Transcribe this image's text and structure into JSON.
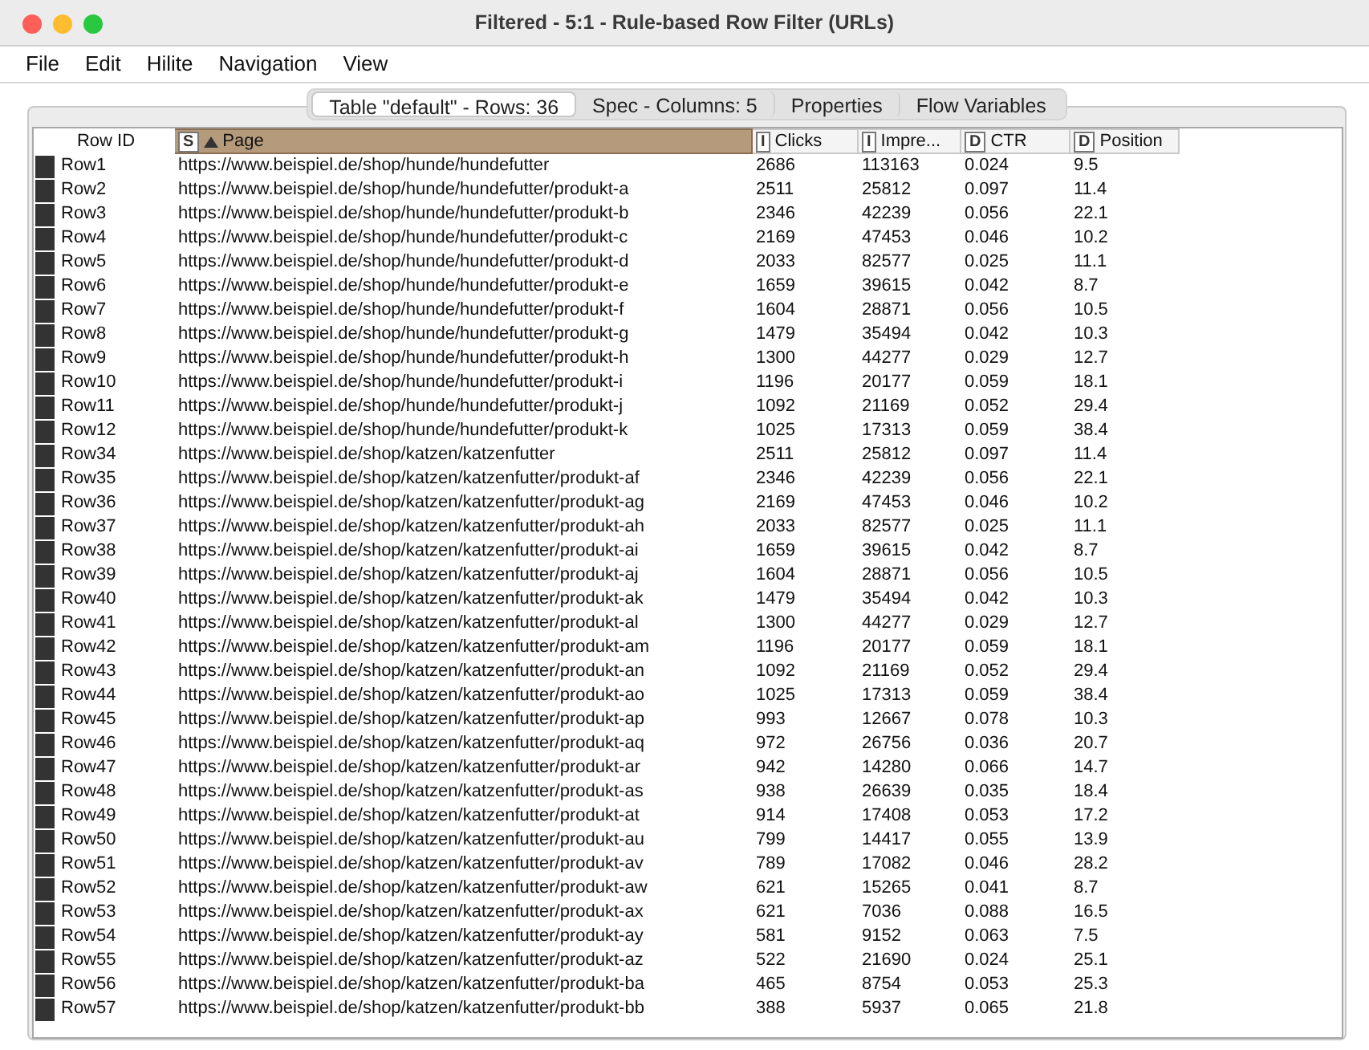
{
  "window": {
    "title": "Filtered - 5:1 - Rule-based Row Filter (URLs)"
  },
  "menu": [
    "File",
    "Edit",
    "Hilite",
    "Navigation",
    "View"
  ],
  "tabs": [
    {
      "label": "Table \"default\" - Rows: 36",
      "selected": true
    },
    {
      "label": "Spec - Columns: 5",
      "selected": false
    },
    {
      "label": "Properties",
      "selected": false
    },
    {
      "label": "Flow Variables",
      "selected": false
    }
  ],
  "table": {
    "columns": [
      {
        "label": "Row ID",
        "selected": false
      },
      {
        "label": "Page",
        "type": "S",
        "sorted_ascending": true,
        "selected": true
      },
      {
        "label": "Clicks",
        "type": "I",
        "selected": false
      },
      {
        "label": "Impre...",
        "type": "I",
        "selected": false
      },
      {
        "label": "CTR",
        "type": "D",
        "selected": false
      },
      {
        "label": "Position",
        "type": "D",
        "selected": false
      }
    ],
    "rows": [
      [
        "Row1",
        "https://www.beispiel.de/shop/hunde/hundefutter",
        "2686",
        "113163",
        "0.024",
        "9.5"
      ],
      [
        "Row2",
        "https://www.beispiel.de/shop/hunde/hundefutter/produkt-a",
        "2511",
        "25812",
        "0.097",
        "11.4"
      ],
      [
        "Row3",
        "https://www.beispiel.de/shop/hunde/hundefutter/produkt-b",
        "2346",
        "42239",
        "0.056",
        "22.1"
      ],
      [
        "Row4",
        "https://www.beispiel.de/shop/hunde/hundefutter/produkt-c",
        "2169",
        "47453",
        "0.046",
        "10.2"
      ],
      [
        "Row5",
        "https://www.beispiel.de/shop/hunde/hundefutter/produkt-d",
        "2033",
        "82577",
        "0.025",
        "11.1"
      ],
      [
        "Row6",
        "https://www.beispiel.de/shop/hunde/hundefutter/produkt-e",
        "1659",
        "39615",
        "0.042",
        "8.7"
      ],
      [
        "Row7",
        "https://www.beispiel.de/shop/hunde/hundefutter/produkt-f",
        "1604",
        "28871",
        "0.056",
        "10.5"
      ],
      [
        "Row8",
        "https://www.beispiel.de/shop/hunde/hundefutter/produkt-g",
        "1479",
        "35494",
        "0.042",
        "10.3"
      ],
      [
        "Row9",
        "https://www.beispiel.de/shop/hunde/hundefutter/produkt-h",
        "1300",
        "44277",
        "0.029",
        "12.7"
      ],
      [
        "Row10",
        "https://www.beispiel.de/shop/hunde/hundefutter/produkt-i",
        "1196",
        "20177",
        "0.059",
        "18.1"
      ],
      [
        "Row11",
        "https://www.beispiel.de/shop/hunde/hundefutter/produkt-j",
        "1092",
        "21169",
        "0.052",
        "29.4"
      ],
      [
        "Row12",
        "https://www.beispiel.de/shop/hunde/hundefutter/produkt-k",
        "1025",
        "17313",
        "0.059",
        "38.4"
      ],
      [
        "Row34",
        "https://www.beispiel.de/shop/katzen/katzenfutter",
        "2511",
        "25812",
        "0.097",
        "11.4"
      ],
      [
        "Row35",
        "https://www.beispiel.de/shop/katzen/katzenfutter/produkt-af",
        "2346",
        "42239",
        "0.056",
        "22.1"
      ],
      [
        "Row36",
        "https://www.beispiel.de/shop/katzen/katzenfutter/produkt-ag",
        "2169",
        "47453",
        "0.046",
        "10.2"
      ],
      [
        "Row37",
        "https://www.beispiel.de/shop/katzen/katzenfutter/produkt-ah",
        "2033",
        "82577",
        "0.025",
        "11.1"
      ],
      [
        "Row38",
        "https://www.beispiel.de/shop/katzen/katzenfutter/produkt-ai",
        "1659",
        "39615",
        "0.042",
        "8.7"
      ],
      [
        "Row39",
        "https://www.beispiel.de/shop/katzen/katzenfutter/produkt-aj",
        "1604",
        "28871",
        "0.056",
        "10.5"
      ],
      [
        "Row40",
        "https://www.beispiel.de/shop/katzen/katzenfutter/produkt-ak",
        "1479",
        "35494",
        "0.042",
        "10.3"
      ],
      [
        "Row41",
        "https://www.beispiel.de/shop/katzen/katzenfutter/produkt-al",
        "1300",
        "44277",
        "0.029",
        "12.7"
      ],
      [
        "Row42",
        "https://www.beispiel.de/shop/katzen/katzenfutter/produkt-am",
        "1196",
        "20177",
        "0.059",
        "18.1"
      ],
      [
        "Row43",
        "https://www.beispiel.de/shop/katzen/katzenfutter/produkt-an",
        "1092",
        "21169",
        "0.052",
        "29.4"
      ],
      [
        "Row44",
        "https://www.beispiel.de/shop/katzen/katzenfutter/produkt-ao",
        "1025",
        "17313",
        "0.059",
        "38.4"
      ],
      [
        "Row45",
        "https://www.beispiel.de/shop/katzen/katzenfutter/produkt-ap",
        "993",
        "12667",
        "0.078",
        "10.3"
      ],
      [
        "Row46",
        "https://www.beispiel.de/shop/katzen/katzenfutter/produkt-aq",
        "972",
        "26756",
        "0.036",
        "20.7"
      ],
      [
        "Row47",
        "https://www.beispiel.de/shop/katzen/katzenfutter/produkt-ar",
        "942",
        "14280",
        "0.066",
        "14.7"
      ],
      [
        "Row48",
        "https://www.beispiel.de/shop/katzen/katzenfutter/produkt-as",
        "938",
        "26639",
        "0.035",
        "18.4"
      ],
      [
        "Row49",
        "https://www.beispiel.de/shop/katzen/katzenfutter/produkt-at",
        "914",
        "17408",
        "0.053",
        "17.2"
      ],
      [
        "Row50",
        "https://www.beispiel.de/shop/katzen/katzenfutter/produkt-au",
        "799",
        "14417",
        "0.055",
        "13.9"
      ],
      [
        "Row51",
        "https://www.beispiel.de/shop/katzen/katzenfutter/produkt-av",
        "789",
        "17082",
        "0.046",
        "28.2"
      ],
      [
        "Row52",
        "https://www.beispiel.de/shop/katzen/katzenfutter/produkt-aw",
        "621",
        "15265",
        "0.041",
        "8.7"
      ],
      [
        "Row53",
        "https://www.beispiel.de/shop/katzen/katzenfutter/produkt-ax",
        "621",
        "7036",
        "0.088",
        "16.5"
      ],
      [
        "Row54",
        "https://www.beispiel.de/shop/katzen/katzenfutter/produkt-ay",
        "581",
        "9152",
        "0.063",
        "7.5"
      ],
      [
        "Row55",
        "https://www.beispiel.de/shop/katzen/katzenfutter/produkt-az",
        "522",
        "21690",
        "0.024",
        "25.1"
      ],
      [
        "Row56",
        "https://www.beispiel.de/shop/katzen/katzenfutter/produkt-ba",
        "465",
        "8754",
        "0.053",
        "25.3"
      ],
      [
        "Row57",
        "https://www.beispiel.de/shop/katzen/katzenfutter/produkt-bb",
        "388",
        "5937",
        "0.065",
        "21.8"
      ]
    ]
  }
}
